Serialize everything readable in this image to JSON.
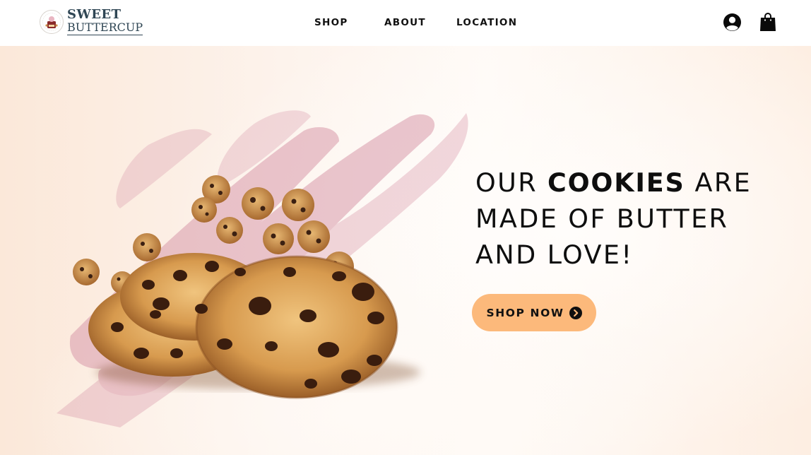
{
  "header": {
    "brand": {
      "line1": "SWEET",
      "line2": "BUTTERCUP",
      "icon": "bakery-emblem-icon"
    },
    "nav": [
      {
        "label": "SHOP"
      },
      {
        "label": "ABOUT"
      },
      {
        "label": "LOCATION"
      }
    ],
    "actions": {
      "account_icon": "user-circle-icon",
      "cart_icon": "shopping-bag-icon"
    }
  },
  "hero": {
    "headline": {
      "part1": "OUR ",
      "emphasis": "COOKIES",
      "part2": " ARE",
      "line2": "MADE OF BUTTER",
      "line3": "AND LOVE!"
    },
    "cta": {
      "label": "SHOP NOW",
      "icon": "chevron-right-circle-icon"
    },
    "image": "chocolate-chip-cookies-image"
  },
  "colors": {
    "cta_background": "#fcb97b",
    "brand_text": "#2f4654",
    "brush_stroke": "#d99aab",
    "text": "#0e0e0e"
  }
}
